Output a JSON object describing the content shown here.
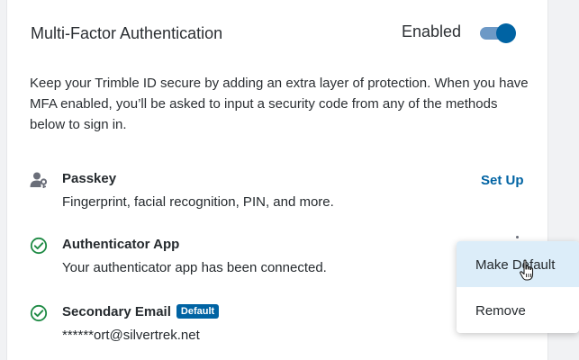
{
  "section": {
    "title": "Multi-Factor Authentication",
    "status_label": "Enabled",
    "toggle_on": true,
    "description": "Keep your Trimble ID secure by adding an extra layer of protection. When you have MFA enabled, you’ll be asked to input a security code from any of the methods below to sign in."
  },
  "methods": [
    {
      "name": "Passkey",
      "detail": "Fingerprint, facial recognition, PIN, and more.",
      "icon": "person-key-icon",
      "action_label": "Set Up"
    },
    {
      "name": "Authenticator App",
      "detail": "Your authenticator app has been connected.",
      "icon": "check-circle-icon"
    },
    {
      "name": "Secondary Email",
      "badge": "Default",
      "detail": "******ort@silvertrek.net",
      "icon": "check-circle-icon"
    }
  ],
  "context_menu": {
    "items": [
      "Make Default",
      "Remove"
    ],
    "hovered": "Make Default"
  },
  "colors": {
    "accent": "#0063a3",
    "success": "#1e8a44",
    "toggle_track": "#6d99c6",
    "menu_hover": "#dcedf9"
  }
}
